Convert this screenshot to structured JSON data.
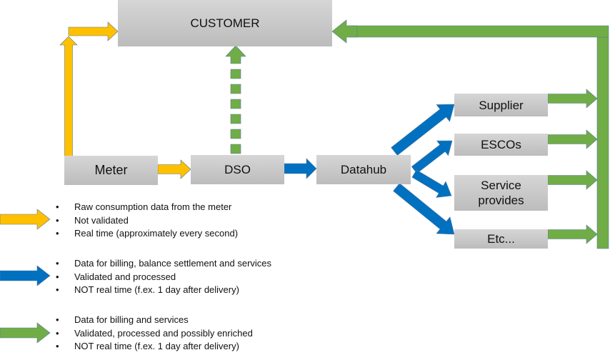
{
  "colors": {
    "yellow": "#ffc000",
    "blue": "#0070c0",
    "green": "#70ad47",
    "box": "#c8c8c8"
  },
  "nodes": {
    "customer": "CUSTOMER",
    "meter": "Meter",
    "dso": "DSO",
    "datahub": "Datahub",
    "supplier": "Supplier",
    "escos": "ESCOs",
    "service_1": "Service",
    "service_2": "provides",
    "etc": "Etc..."
  },
  "legend": [
    {
      "color": "yellow",
      "items": [
        "Raw consumption data from the meter",
        "Not validated",
        "Real time (approximately every second)"
      ]
    },
    {
      "color": "blue",
      "items": [
        "Data for billing, balance settlement and services",
        "Validated and processed",
        "NOT real time (f.ex. 1 day after delivery)"
      ]
    },
    {
      "color": "green",
      "items": [
        "Data for billing and services",
        "Validated, processed and possibly enriched",
        "NOT real time (f.ex. 1 day after delivery)"
      ]
    }
  ],
  "bullet": "•"
}
